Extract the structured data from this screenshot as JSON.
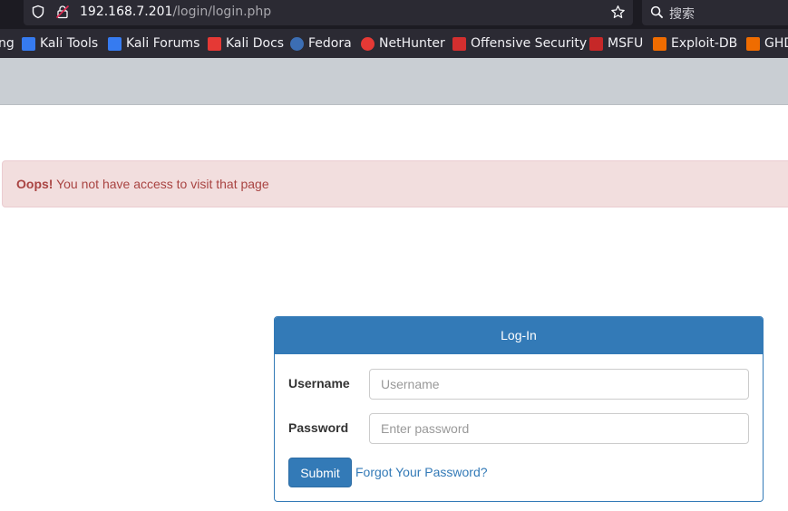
{
  "browser": {
    "url_host": "192.168.7.201",
    "url_path": "/login/login.php",
    "search_placeholder": "搜索"
  },
  "bookmarks": [
    {
      "label": "ng",
      "icon": "none"
    },
    {
      "label": "Kali Tools",
      "icon": "kali-dragon-icon",
      "color": "#367bf0"
    },
    {
      "label": "Kali Forums",
      "icon": "kali-dragon-icon",
      "color": "#367bf0"
    },
    {
      "label": "Kali Docs",
      "icon": "kali-docs-icon",
      "color": "#e53935"
    },
    {
      "label": "Fedora",
      "icon": "fedora-icon",
      "color": "#3c6eb4"
    },
    {
      "label": "NetHunter",
      "icon": "nethunter-icon",
      "color": "#e53935"
    },
    {
      "label": "Offensive Security",
      "icon": "offsec-icon",
      "color": "#d32f2f"
    },
    {
      "label": "MSFU",
      "icon": "msfu-icon",
      "color": "#c62828"
    },
    {
      "label": "Exploit-DB",
      "icon": "exploitdb-icon",
      "color": "#ef6c00"
    },
    {
      "label": "GHD",
      "icon": "ghdb-icon",
      "color": "#ef6c00"
    }
  ],
  "alert": {
    "strong": "Oops!",
    "message": " You not have access to visit that page"
  },
  "login": {
    "title": "Log-In",
    "username_label": "Username",
    "username_placeholder": "Username",
    "password_label": "Password",
    "password_placeholder": "Enter password",
    "submit_label": "Submit",
    "forgot_label": "Forgot Your Password?"
  }
}
